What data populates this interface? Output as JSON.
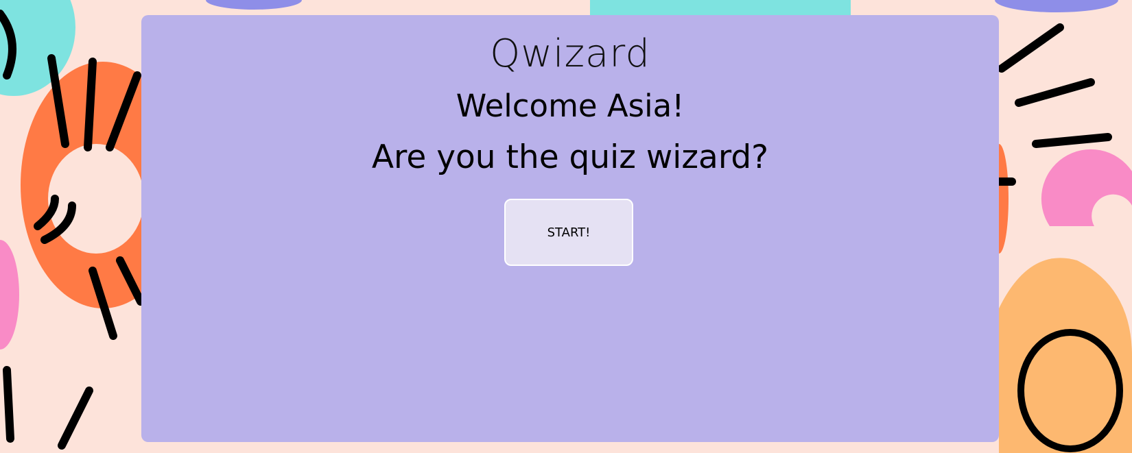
{
  "app": {
    "title": "Qwizard"
  },
  "main": {
    "welcome": "Welcome Asia!",
    "question": "Are you the quiz wizard?",
    "start_label": "START!"
  },
  "colors": {
    "panel": "#b9b1ea",
    "button": "#e5e1f3",
    "background": "#fde3da"
  }
}
